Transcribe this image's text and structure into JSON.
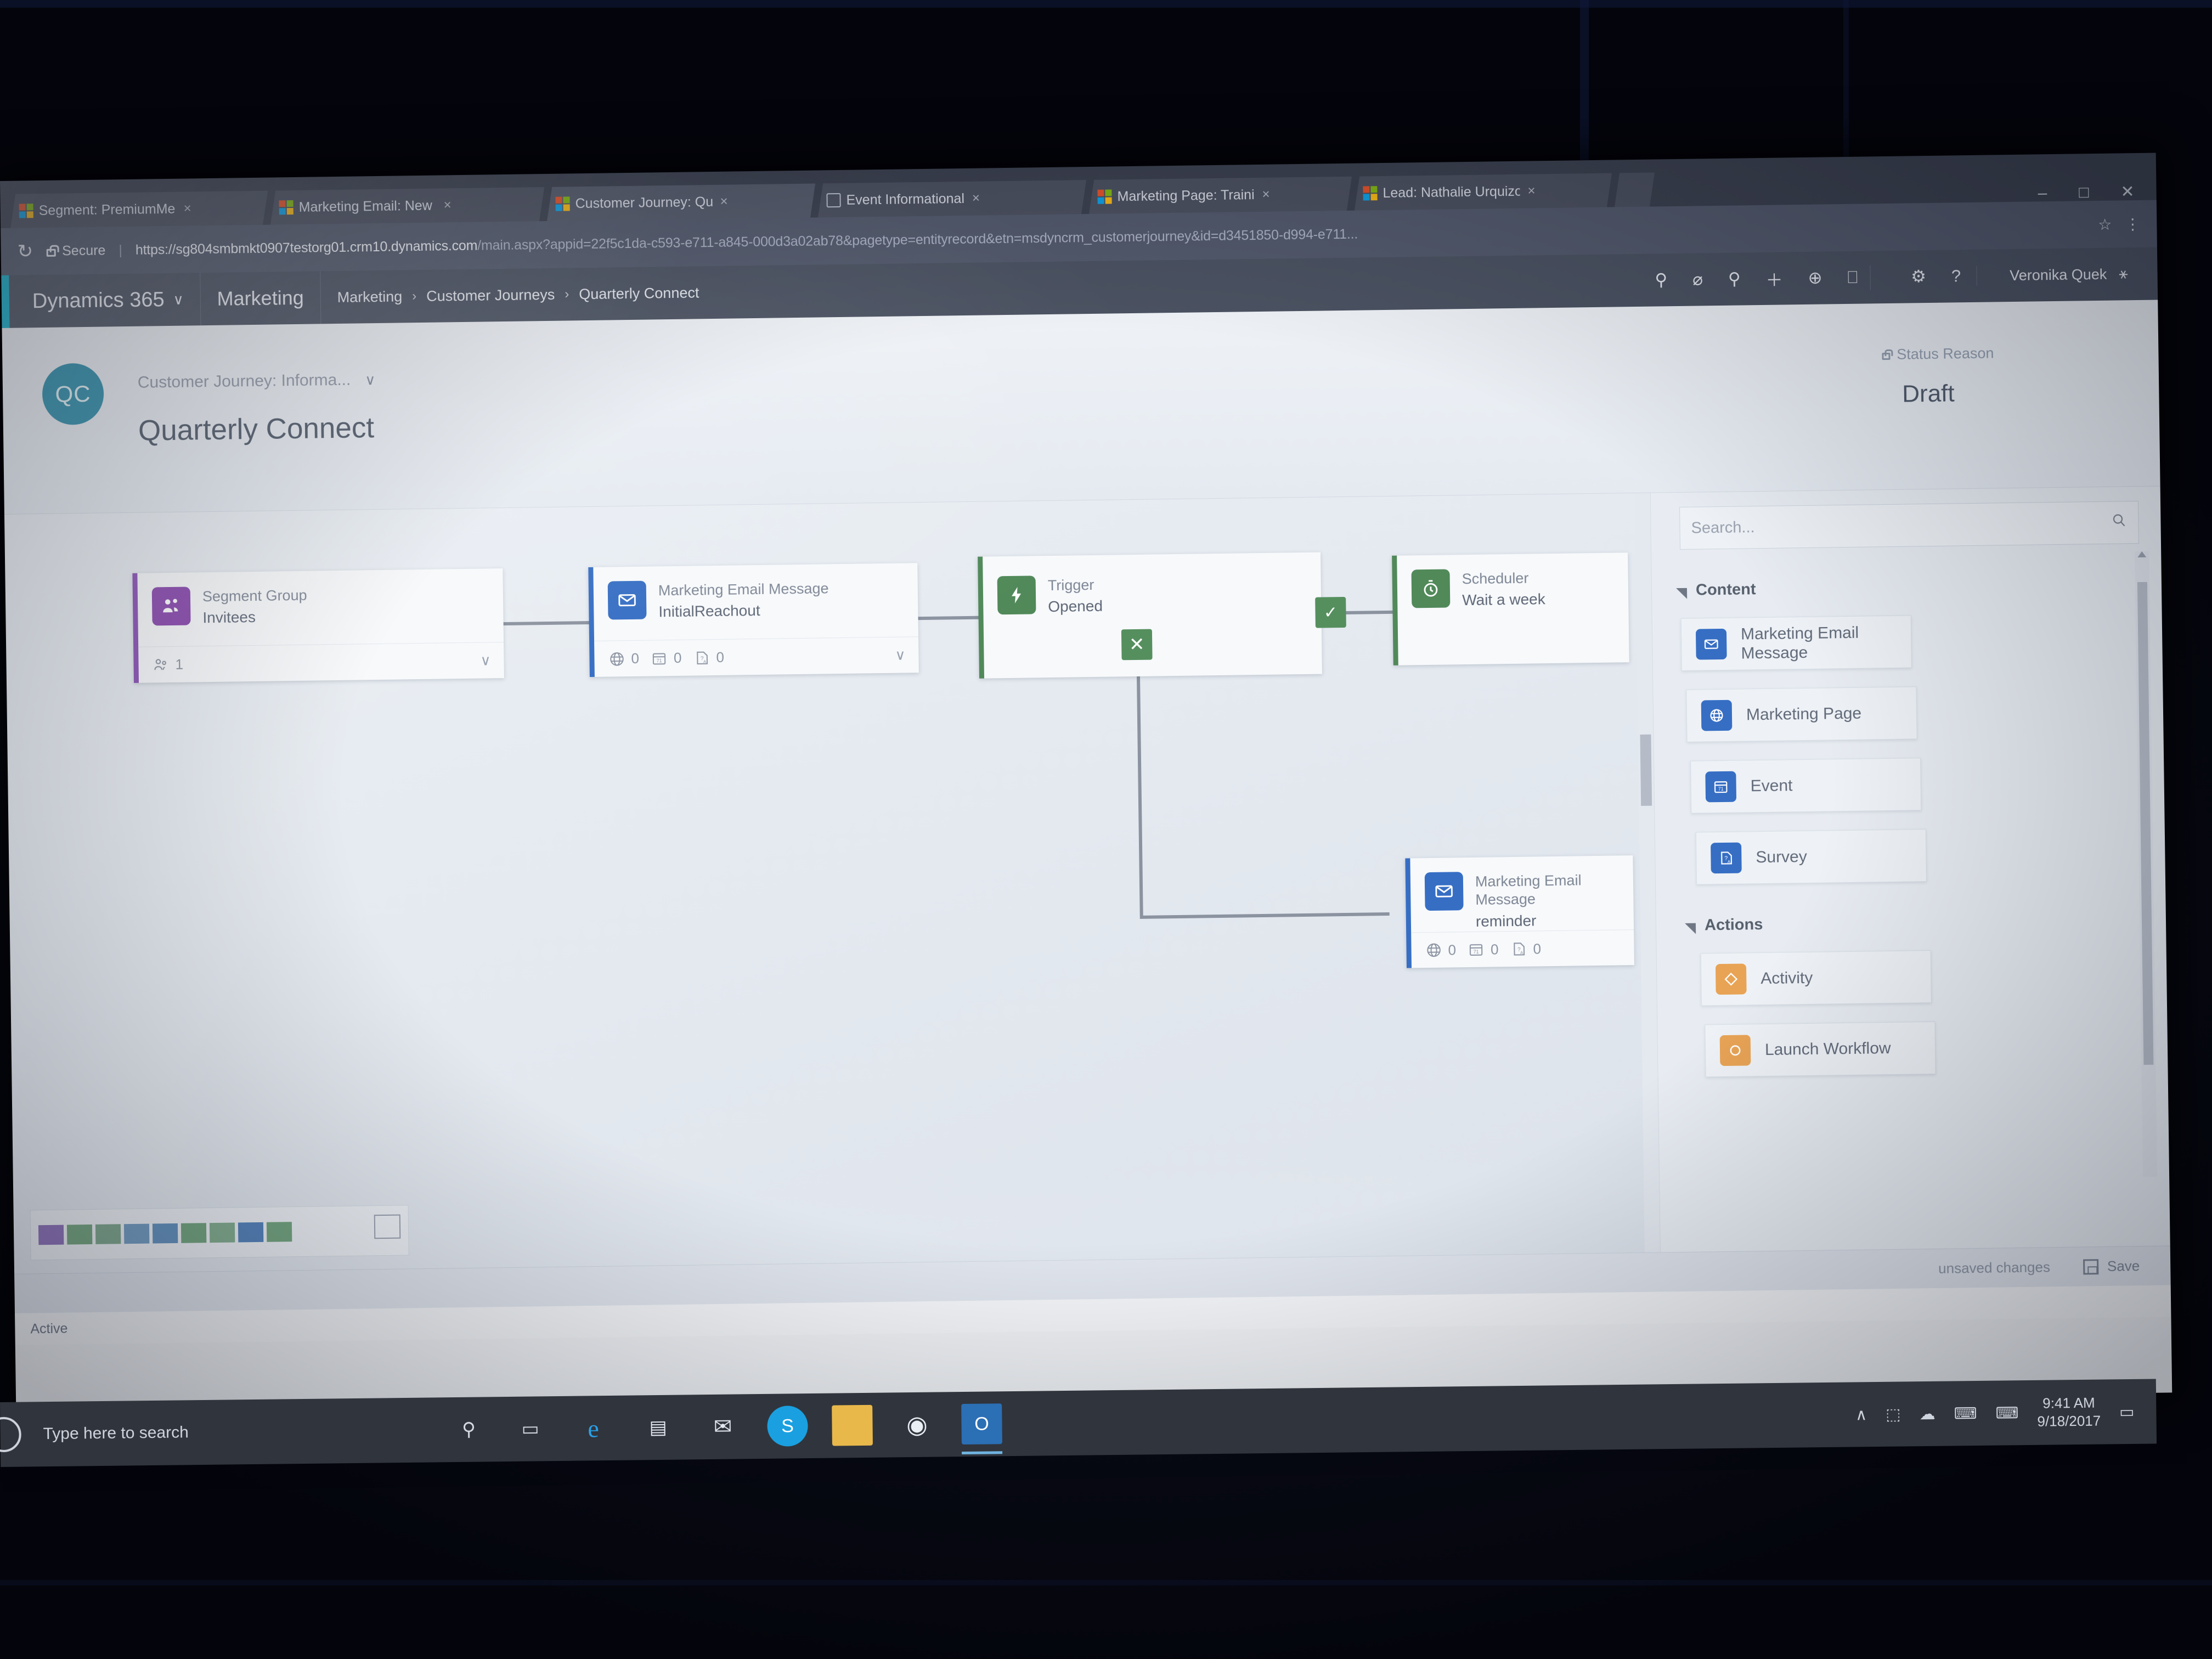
{
  "browser": {
    "tabs": [
      {
        "title": "Segment: PremiumMem",
        "favicon": "windows-logo-icon",
        "close": "×"
      },
      {
        "title": "Marketing Email: New M",
        "favicon": "windows-logo-icon",
        "close": "×"
      },
      {
        "title": "Customer Journey: Quar",
        "favicon": "windows-logo-icon",
        "close": "×"
      },
      {
        "title": "Event Informational",
        "favicon": "page-icon",
        "close": "×"
      },
      {
        "title": "Marketing Page: Training",
        "favicon": "windows-logo-icon",
        "close": "×"
      },
      {
        "title": "Lead: Nathalie Urquizo",
        "favicon": "windows-logo-icon",
        "close": "×"
      }
    ],
    "window_controls": {
      "minimize": "–",
      "maximize": "□",
      "close": "✕"
    },
    "reload_icon": "↻",
    "security_label": "Secure",
    "url_separator": "|",
    "url_host": "https://sg804smbmkt0907testorg01.crm10.dynamics.com",
    "url_path": "/main.aspx?appid=22f5c1da-c593-e711-a845-000d3a02ab78&pagetype=entityrecord&etn=msdyncrm_customerjourney&id=d3451850-d994-e711...",
    "star_icon": "☆",
    "menu_icon": "⋮"
  },
  "navbar": {
    "brand": "Dynamics 365",
    "brand_chevron": "∨",
    "area": "Marketing",
    "breadcrumb": [
      "Marketing",
      "Customer Journeys",
      "Quarterly Connect"
    ],
    "breadcrumb_separator": "›",
    "icons": [
      "search-icon",
      "assistant-icon",
      "insights-icon",
      "quick-create-icon",
      "advanced-find-icon",
      "notes-icon"
    ],
    "icon_glyphs": [
      "⚲",
      "⌀",
      "⚲",
      "＋",
      "⊕",
      "⎕"
    ],
    "settings_icon": "⚙",
    "help_icon": "?",
    "user_name": "Veronika Quek",
    "user_icon": "⚹",
    "accent_color": "#00b7d4"
  },
  "record": {
    "avatar_initials": "QC",
    "avatar_color": "#1f8fb0",
    "subtitle": "Customer Journey: Informa...",
    "subtitle_chevron": "∨",
    "title": "Quarterly Connect",
    "status_label": "Status Reason",
    "status_value": "Draft"
  },
  "canvas": {
    "tiles": [
      {
        "id": "segment-group",
        "type_label": "Segment Group",
        "name": "Invitees",
        "icon": "segment-group-icon",
        "accent": "#8e44b8",
        "metrics": [
          {
            "icon": "members-icon",
            "value": "1"
          }
        ],
        "chevron": "∨"
      },
      {
        "id": "marketing-email-initial",
        "type_label": "Marketing Email Message",
        "name": "InitialReachout",
        "icon": "email-icon",
        "accent": "#2f6fd0",
        "metrics": [
          {
            "icon": "globe-icon",
            "value": "0"
          },
          {
            "icon": "event-icon",
            "value": "0"
          },
          {
            "icon": "survey-icon",
            "value": "0"
          }
        ],
        "chevron": "∨"
      },
      {
        "id": "trigger-opened",
        "type_label": "Trigger",
        "name": "Opened",
        "icon": "lightning-icon",
        "accent": "#4b8b55",
        "metrics": [],
        "badge_true": "✓",
        "badge_false": "✕"
      },
      {
        "id": "scheduler-wait",
        "type_label": "Scheduler",
        "name": "Wait a week",
        "icon": "timer-icon",
        "accent": "#4b8b55",
        "metrics": []
      },
      {
        "id": "marketing-email-reminder",
        "type_label": "Marketing Email Message",
        "name": "reminder",
        "icon": "email-icon",
        "accent": "#2f6fd0",
        "metrics": [
          {
            "icon": "globe-icon",
            "value": "0"
          },
          {
            "icon": "event-icon",
            "value": "0"
          },
          {
            "icon": "survey-icon",
            "value": "0"
          }
        ]
      }
    ]
  },
  "palette": {
    "search_placeholder": "Search...",
    "search_value": "",
    "search_icon": "search-icon",
    "groups": [
      {
        "title": "Content",
        "items": [
          {
            "label": "Marketing Email Message",
            "icon": "email-icon",
            "color": "blue"
          },
          {
            "label": "Marketing Page",
            "icon": "globe-icon",
            "color": "blue"
          },
          {
            "label": "Event",
            "icon": "event-icon",
            "color": "blue"
          },
          {
            "label": "Survey",
            "icon": "survey-icon",
            "color": "blue"
          }
        ]
      },
      {
        "title": "Actions",
        "items": [
          {
            "label": "Activity",
            "icon": "diamond-icon",
            "color": "orange"
          },
          {
            "label": "Launch Workflow",
            "icon": "circle-icon",
            "color": "orange"
          }
        ]
      }
    ]
  },
  "footer": {
    "unsaved_text": "unsaved changes",
    "save_label": "Save",
    "window_status": "Active"
  },
  "taskbar": {
    "search_placeholder": "Type here to search",
    "cortana_icon": "cortana-icon",
    "mic_icon": "⚲",
    "taskview_icon": "▭",
    "apps": [
      {
        "name": "edge",
        "glyph": "e",
        "color": "#1a7fc4"
      },
      {
        "name": "store",
        "glyph": "▤",
        "color": "#2b6fb5"
      },
      {
        "name": "mail",
        "glyph": "✉",
        "color": "#d8dde5"
      },
      {
        "name": "skype",
        "glyph": "S",
        "color": "#1aa0e0"
      },
      {
        "name": "explorer",
        "glyph": "⬛",
        "color": "#e8b84b"
      },
      {
        "name": "chrome",
        "glyph": "◉",
        "color": "#e8e8e8"
      },
      {
        "name": "outlook",
        "glyph": "O",
        "color": "#2b6fb5"
      }
    ],
    "tray_icons": [
      "∧",
      "⬚",
      "☁",
      "⌨",
      "⌨"
    ],
    "time": "9:41 AM",
    "date": "9/18/2017",
    "notification_icon": "▭"
  }
}
